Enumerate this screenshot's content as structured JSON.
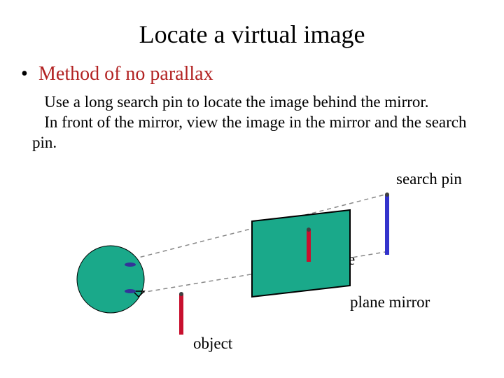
{
  "title": "Locate a virtual image",
  "bullet": {
    "dot": "•",
    "text": "Method of no parallax"
  },
  "body": "   Use a long search pin to locate the image behind the mirror.\n   In front of the mirror, view the image in the mirror and the search pin.",
  "labels": {
    "search_pin": "search pin",
    "image": "image",
    "plane_mirror": "plane mirror",
    "object": "object"
  },
  "colors": {
    "mirror_fill": "#1aa98a",
    "mirror_stroke": "#000000",
    "head_fill": "#1aa98a",
    "object_pin": "#c8102e",
    "image_pin": "#c8102e",
    "search_pin": "#3333cc",
    "sightline": "#888888",
    "eye_feature": "#333399"
  }
}
